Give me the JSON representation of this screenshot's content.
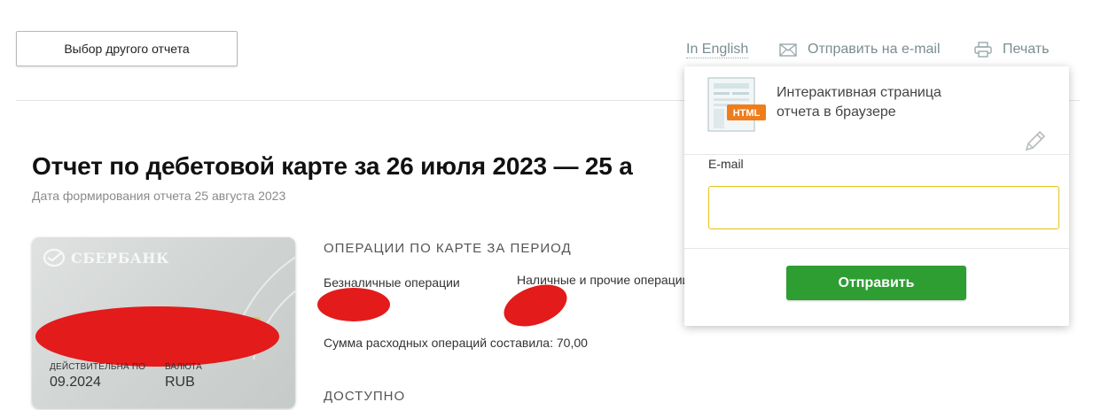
{
  "toolbar": {
    "select_report_label": "Выбор другого отчета",
    "in_english_label": "In English",
    "send_email_label": "Отправить на e-mail",
    "print_label": "Печать"
  },
  "report": {
    "title": "Отчет по дебетовой карте за 26 июля 2023 — 25 а",
    "generated_date": "Дата формирования отчета 25 августа 2023"
  },
  "card": {
    "bank_name": "СБЕРБАНК",
    "valid_label": "ДЕЙСТВИТЕЛЬНА ПО",
    "valid_value": "09.2024",
    "currency_label": "ВАЛЮТА",
    "currency_value": "RUB"
  },
  "operations": {
    "heading": "ОПЕРАЦИИ ПО КАРТЕ ЗА ПЕРИОД",
    "cashless_label": "Безналичные операции",
    "cash_label": "Наличные и прочие операции",
    "expense_sum_text": "Сумма расходных операций составила: 70,00",
    "available_heading": "ДОСТУПНО"
  },
  "email_popup": {
    "doc_icon_badge": "HTML",
    "description_line1": "Интерактивная страница",
    "description_line2": "отчета в браузере",
    "email_label": "E-mail",
    "email_value": "",
    "send_button_label": "Отправить"
  },
  "colors": {
    "accent_green": "#2e9e33",
    "input_border_yellow": "#e5c21b",
    "link_gray": "#7a8d92",
    "redaction_red": "#e31b1b",
    "html_badge_orange": "#f07d1b"
  }
}
